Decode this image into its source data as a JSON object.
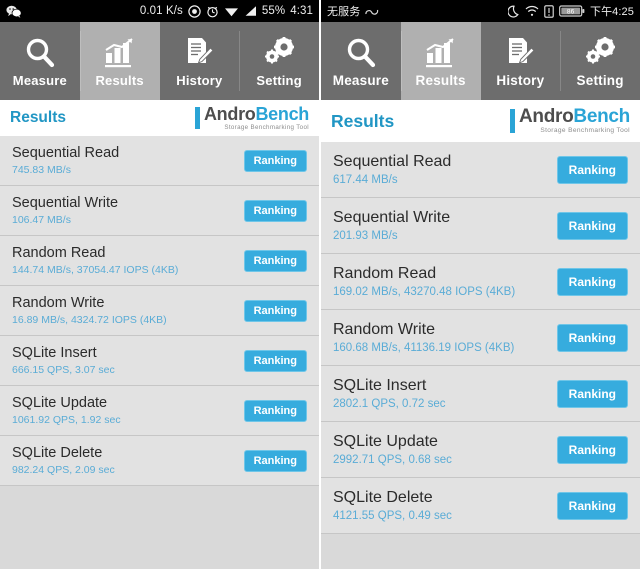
{
  "left": {
    "statusbar": {
      "network_speed": "0.01 K/s",
      "battery": "55%",
      "time": "4:31",
      "icons": [
        "wechat-icon",
        "target-icon",
        "alarm-icon",
        "wifi-icon",
        "signal-icon"
      ]
    },
    "tabs": [
      {
        "label": "Measure",
        "icon": "magnifier-icon",
        "active": false
      },
      {
        "label": "Results",
        "icon": "bar-chart-icon",
        "active": true
      },
      {
        "label": "History",
        "icon": "document-pencil-icon",
        "active": false
      },
      {
        "label": "Setting",
        "icon": "gears-icon",
        "active": false
      }
    ],
    "header": {
      "title": "Results",
      "logo_main_a": "Andro",
      "logo_main_b": "Bench",
      "logo_sub": "Storage Benchmarking Tool"
    },
    "rows": [
      {
        "title": "Sequential Read",
        "value": "745.83 MB/s",
        "button": "Ranking"
      },
      {
        "title": "Sequential Write",
        "value": "106.47 MB/s",
        "button": "Ranking"
      },
      {
        "title": "Random Read",
        "value": "144.74 MB/s, 37054.47 IOPS (4KB)",
        "button": "Ranking"
      },
      {
        "title": "Random Write",
        "value": "16.89 MB/s, 4324.72 IOPS (4KB)",
        "button": "Ranking"
      },
      {
        "title": "SQLite Insert",
        "value": "666.15 QPS, 3.07 sec",
        "button": "Ranking"
      },
      {
        "title": "SQLite Update",
        "value": "1061.92 QPS, 1.92 sec",
        "button": "Ranking"
      },
      {
        "title": "SQLite Delete",
        "value": "982.24 QPS, 2.09 sec",
        "button": "Ranking"
      }
    ]
  },
  "right": {
    "statusbar": {
      "carrier": "无服务",
      "battery": "86",
      "time": "下午4:25",
      "icons": [
        "link-icon",
        "moon-icon",
        "wifi-icon",
        "sim-icon",
        "battery-icon"
      ]
    },
    "tabs": [
      {
        "label": "Measure",
        "icon": "magnifier-icon",
        "active": false
      },
      {
        "label": "Results",
        "icon": "bar-chart-icon",
        "active": true
      },
      {
        "label": "History",
        "icon": "document-pencil-icon",
        "active": false
      },
      {
        "label": "Setting",
        "icon": "gears-icon",
        "active": false
      }
    ],
    "header": {
      "title": "Results",
      "logo_main_a": "Andro",
      "logo_main_b": "Bench",
      "logo_sub": "Storage Benchmarking Tool"
    },
    "rows": [
      {
        "title": "Sequential Read",
        "value": "617.44 MB/s",
        "button": "Ranking"
      },
      {
        "title": "Sequential Write",
        "value": "201.93 MB/s",
        "button": "Ranking"
      },
      {
        "title": "Random Read",
        "value": "169.02 MB/s, 43270.48 IOPS (4KB)",
        "button": "Ranking"
      },
      {
        "title": "Random Write",
        "value": "160.68 MB/s, 41136.19 IOPS (4KB)",
        "button": "Ranking"
      },
      {
        "title": "SQLite Insert",
        "value": "2802.1 QPS, 0.72 sec",
        "button": "Ranking"
      },
      {
        "title": "SQLite Update",
        "value": "2992.71 QPS, 0.68 sec",
        "button": "Ranking"
      },
      {
        "title": "SQLite Delete",
        "value": "4121.55 QPS, 0.49 sec",
        "button": "Ranking"
      }
    ]
  },
  "colors": {
    "accent": "#36acde",
    "title": "#2196c4",
    "tabbar": "#6d6d6d",
    "tab_active": "#b0b0b0",
    "row_bg": "#e2e2e2",
    "page_bg": "#d9d9d9"
  }
}
